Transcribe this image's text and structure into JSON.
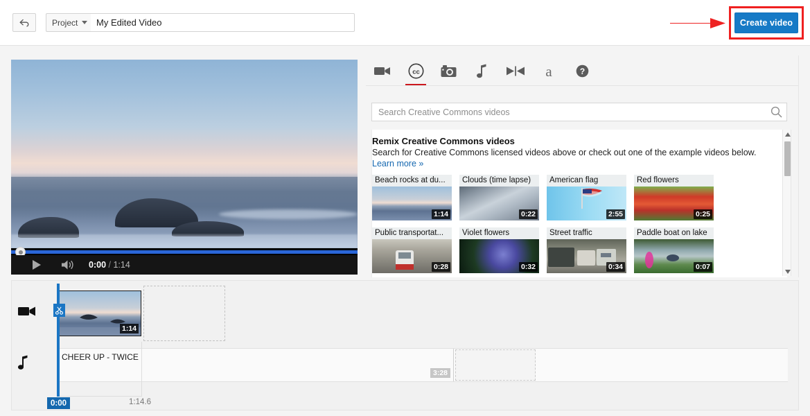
{
  "topbar": {
    "back_icon": "back-arrow-icon",
    "project_label": "Project",
    "project_caret_icon": "chevron-down-icon",
    "title_value": "My Edited Video",
    "title_placeholder": "Video title",
    "create_video_label": "Create video",
    "accent_blue": "#167ac6",
    "annotation_color": "#ef2020"
  },
  "player": {
    "play_icon": "play-icon",
    "volume_icon": "volume-icon",
    "current_time": "0:00",
    "separator": "/",
    "duration": "1:14",
    "progress_percent": 0
  },
  "tabs": [
    {
      "name": "tab-video",
      "icon": "video-camera-icon",
      "active": false
    },
    {
      "name": "tab-creative-commons",
      "icon": "creative-commons-icon",
      "active": true
    },
    {
      "name": "tab-photo",
      "icon": "camera-icon",
      "active": false
    },
    {
      "name": "tab-audio",
      "icon": "music-note-icon",
      "active": false
    },
    {
      "name": "tab-transition",
      "icon": "transition-bowtie-icon",
      "active": false
    },
    {
      "name": "tab-text",
      "icon": "text-a-icon",
      "active": false
    },
    {
      "name": "tab-help",
      "icon": "question-mark-icon",
      "active": false
    }
  ],
  "cc_panel": {
    "search_placeholder": "Search Creative Commons videos",
    "search_value": "",
    "search_icon": "search-icon",
    "heading": "Remix Creative Commons videos",
    "subheading": "Search for Creative Commons licensed videos above or check out one of the example videos below.",
    "learn_more": "Learn more »",
    "scrollbar": {
      "up_icon": "chevron-up-icon",
      "down_icon": "chevron-down-icon"
    },
    "videos": [
      {
        "title": "Beach rocks at du...",
        "duration": "1:14",
        "scene": "sc-beach"
      },
      {
        "title": "Clouds (time lapse)",
        "duration": "0:22",
        "scene": "sc-clouds"
      },
      {
        "title": "American flag",
        "duration": "2:55",
        "scene": "sc-flag"
      },
      {
        "title": "Red flowers",
        "duration": "0:25",
        "scene": "sc-red"
      },
      {
        "title": "Public transportat...",
        "duration": "0:28",
        "scene": "sc-tram"
      },
      {
        "title": "Violet flowers",
        "duration": "0:32",
        "scene": "sc-violet"
      },
      {
        "title": "Street traffic",
        "duration": "0:34",
        "scene": "sc-street"
      },
      {
        "title": "Paddle boat on lake",
        "duration": "0:07",
        "scene": "sc-paddle"
      }
    ]
  },
  "timeline": {
    "video_track_icon": "video-camera-icon",
    "audio_track_icon": "music-note-icon",
    "video_clip": {
      "duration": "1:14",
      "trim_badge_icon": "scissors-icon"
    },
    "audio_clip": {
      "label": "CHEER UP - TWICE",
      "duration": "3:28"
    },
    "playhead_time": "0:00",
    "ruler_label": "1:14.6"
  }
}
